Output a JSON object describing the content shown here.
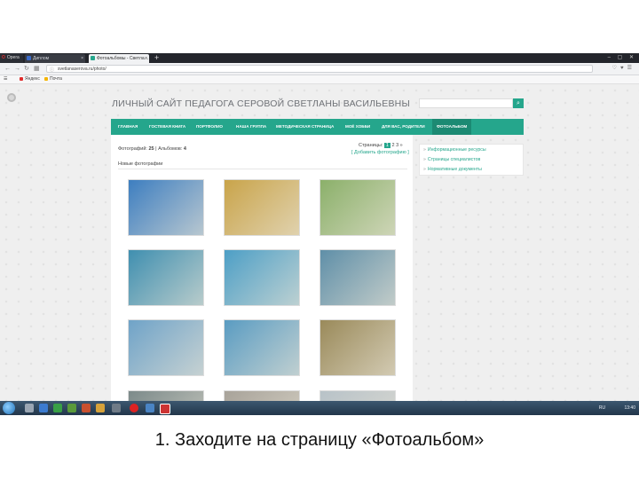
{
  "browser": {
    "menu_label": "Opera",
    "tabs": [
      {
        "title": "Диплом"
      },
      {
        "title": "Фотоальбомы - Светла…"
      }
    ],
    "new_tab": "+",
    "address": {
      "url": "svetlanaserova.ru/photo/"
    },
    "bookmarks": [
      {
        "label": "Яндекс",
        "color": "#e02d2d"
      },
      {
        "label": "Почта",
        "color": "#f4b400"
      }
    ]
  },
  "site": {
    "title": "ЛИЧНЫЙ САЙТ ПЕДАГОГА СЕРОВОЙ СВЕТЛАНЫ ВАСИЛЬЕВНЫ",
    "menu": [
      {
        "label": "ГЛАВНАЯ"
      },
      {
        "label": "ГОСТЕВАЯ КНИГА"
      },
      {
        "label": "ПОРТФОЛИО"
      },
      {
        "label": "НАША ГРУППА"
      },
      {
        "label": "МЕТОДИЧЕСКАЯ СТРАНИЦА"
      },
      {
        "label": "МОЁ ХОББИ"
      },
      {
        "label": "ДЛЯ ВАС, РОДИТЕЛИ"
      },
      {
        "label": "ФОТОАЛЬБОМ"
      }
    ],
    "accent_color": "#25a68c",
    "sidebar": [
      {
        "label": "Информационные ресурсы"
      },
      {
        "label": "Страницы специалистов"
      },
      {
        "label": "Нормативные документы"
      }
    ]
  },
  "album": {
    "photos_label": "Фотографий:",
    "photos_count": "25",
    "albums_label": "| Альбомов:",
    "albums_count": "4",
    "pages_label": "Страницы:",
    "pages": [
      "1",
      "2",
      "3",
      "»"
    ],
    "add_photo": "[ Добавить фотографию ]",
    "new_photos": "Новые фотографии",
    "thumbs": [
      {
        "color": "#3d7ec0"
      },
      {
        "color": "#c9a44a"
      },
      {
        "color": "#8bb06a"
      },
      {
        "color": "#3f8fb0"
      },
      {
        "color": "#4d9fc6"
      },
      {
        "color": "#5f8fa8"
      },
      {
        "color": "#6fa3c8"
      },
      {
        "color": "#5a9cc2"
      },
      {
        "color": "#9a8a5a"
      },
      {
        "color": "#7c8a8a"
      },
      {
        "color": "#a8a39a"
      },
      {
        "color": "#b8c2c8"
      }
    ]
  },
  "taskbar": {
    "lang": "RU",
    "time": "13:40"
  },
  "caption": "1. Заходите на страницу «Фотоальбом»"
}
